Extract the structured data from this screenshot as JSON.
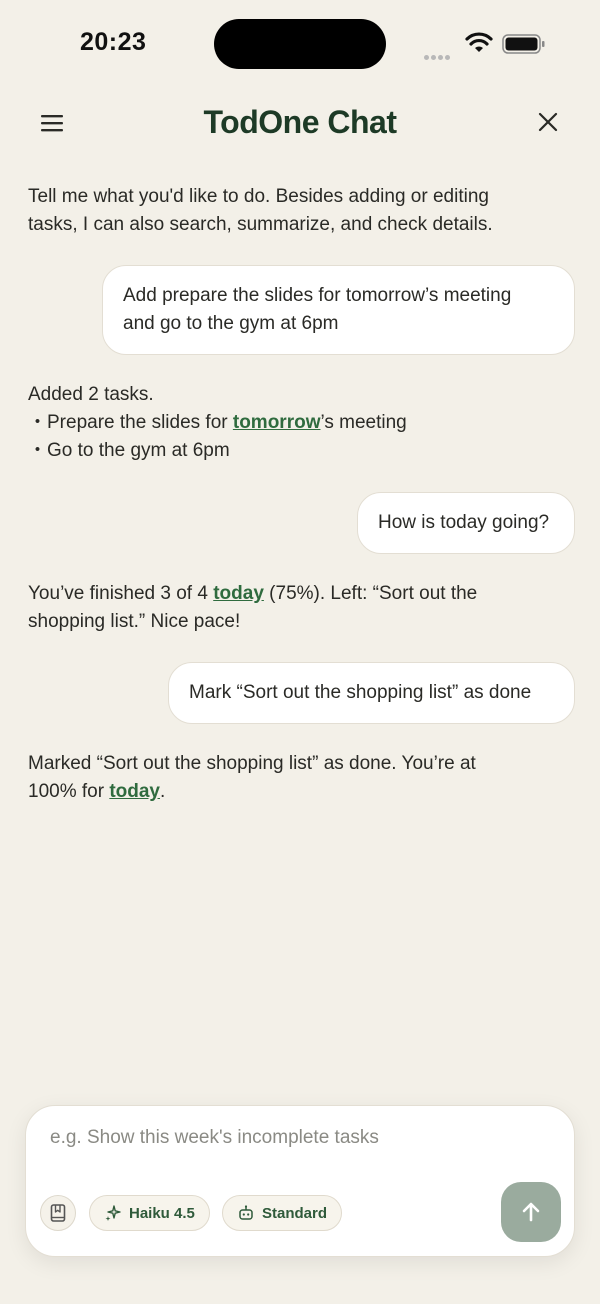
{
  "status": {
    "time": "20:23"
  },
  "header": {
    "title": "TodOne Chat"
  },
  "messages": [
    {
      "role": "assistant",
      "lines": [
        "Tell me what you'd like to do. Besides adding or editing",
        "tasks, I can also search, summarize, and check details."
      ]
    },
    {
      "role": "user",
      "lines": [
        "Add prepare the slides for tomorrow’s meeting",
        "and go to the gym at 6pm"
      ]
    },
    {
      "role": "assistant",
      "intro": "Added 2 tasks.",
      "item1_prefix": "・Prepare the slides for ",
      "item1_link": "tomorrow",
      "item1_suffix": "’s meeting",
      "item2": "・Go to the gym at 6pm"
    },
    {
      "role": "user",
      "text": "How is today going?"
    },
    {
      "role": "assistant",
      "line1_prefix": "You’ve finished 3 of 4 ",
      "line1_link": "today",
      "line1_suffix": " (75%). Left: “Sort out the",
      "line2": "shopping list.” Nice pace!"
    },
    {
      "role": "user",
      "text": "Mark “Sort out the shopping list” as done"
    },
    {
      "role": "assistant",
      "line1": "Marked “Sort out the shopping list” as done. You’re at",
      "line2_prefix": "100% for ",
      "line2_link": "today",
      "line2_suffix": "."
    }
  ],
  "composer": {
    "placeholder": "e.g. Show this week's incomplete tasks",
    "model_label": "Haiku 4.5",
    "mode_label": "Standard"
  },
  "icons": {
    "menu": "hamburger-menu-icon",
    "close": "close-icon",
    "library": "book-icon",
    "model": "sparkle-icon",
    "mode": "robot-icon",
    "send": "arrow-up-icon"
  },
  "colors": {
    "background": "#f3f0e8",
    "title": "#1d3a26",
    "link": "#2f6b3e",
    "send_button": "#9aab9e"
  }
}
